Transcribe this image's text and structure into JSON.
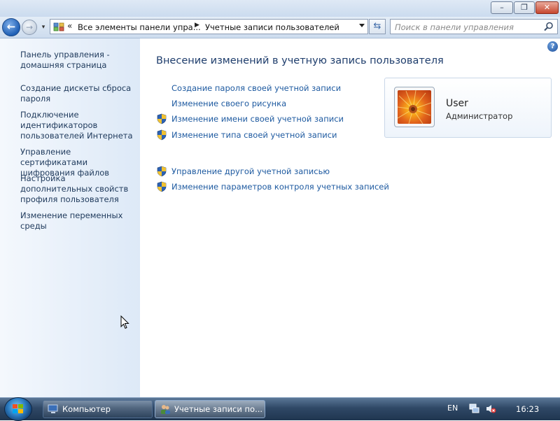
{
  "window": {
    "minimize_glyph": "–",
    "maximize_glyph": "❐",
    "close_glyph": "✕"
  },
  "nav": {
    "back_glyph": "←",
    "forward_glyph": "→",
    "history_glyph": "▾",
    "chevron": "«",
    "crumb1": "Все элементы панели упра...",
    "separator": "▶",
    "crumb2": "Учетные записи пользователей",
    "refresh_glyph": "⇆",
    "search_placeholder": "Поиск в панели управления"
  },
  "sidebar": {
    "items": [
      {
        "label": "Панель управления - домашняя страница"
      },
      {
        "label": "Создание дискеты сброса пароля"
      },
      {
        "label": "Подключение идентификаторов пользователей Интернета"
      },
      {
        "label": "Управление сертификатами шифрования файлов"
      },
      {
        "label": "Настройка дополнительных свойств профиля пользователя"
      },
      {
        "label": "Изменение переменных среды"
      }
    ]
  },
  "main": {
    "title": "Внесение изменений в учетную запись пользователя",
    "help_glyph": "?",
    "tasks": [
      {
        "label": "Создание пароля своей учетной записи",
        "shield": false
      },
      {
        "label": "Изменение своего рисунка",
        "shield": false
      },
      {
        "label": "Изменение имени своей учетной записи",
        "shield": true
      },
      {
        "label": "Изменение типа своей учетной записи",
        "shield": true
      }
    ],
    "other_tasks": [
      {
        "label": "Управление другой учетной записью",
        "shield": true
      },
      {
        "label": "Изменение параметров контроля учетных записей",
        "shield": true
      }
    ]
  },
  "user": {
    "name": "User",
    "role": "Администратор"
  },
  "taskbar": {
    "buttons": [
      {
        "label": "Компьютер"
      },
      {
        "label": "Учетные записи по..."
      }
    ],
    "language": "EN",
    "time": "16:23"
  },
  "icons": {
    "shield": "uac-shield-icon",
    "user_picture": "orange-flower-picture",
    "network": "network-icon",
    "volume": "volume-muted-icon"
  }
}
